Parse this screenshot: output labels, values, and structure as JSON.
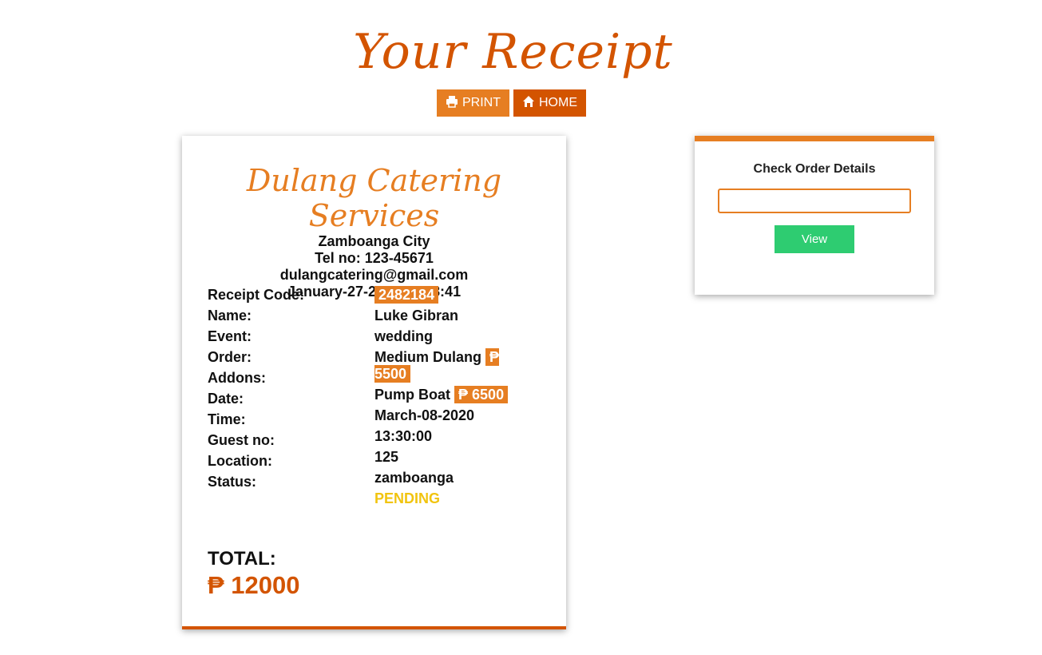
{
  "header": {
    "title": "Your Receipt",
    "print_label": "PRINT",
    "home_label": "HOME",
    "print_icon": "print-icon",
    "home_icon": "home-icon"
  },
  "receipt": {
    "business_name": "Dulang Catering Services",
    "city": "Zamboanga City",
    "tel": "Tel no: 123-45671",
    "email": "dulangcatering@gmail.com",
    "datetime": "January-27-2020 11:08:41",
    "labels": [
      "Receipt Code:",
      "Name:",
      "Event:",
      "Order:",
      "Addons:",
      "Date:",
      "Time:",
      "Guest no:",
      "Location:",
      "Status:"
    ],
    "values": {
      "receipt_code": "2482184",
      "name": "Luke Gibran",
      "event": "wedding",
      "order_name": "Medium Dulang",
      "order_price": "₱ 5500",
      "addon_name": "Pump Boat",
      "addon_price": "₱ 6500",
      "date": "March-08-2020",
      "time": "13:30:00",
      "guest_no": "125",
      "location": "zamboanga",
      "status": "PENDING"
    },
    "total_label": "TOTAL:",
    "total_value": "₱ 12000"
  },
  "check_order": {
    "title": "Check Order Details",
    "input_value": "",
    "button_label": "View"
  },
  "colors": {
    "accent": "#e67e22",
    "accent_dark": "#d35400",
    "view_button": "#2ecc71",
    "status_pending": "#f1c40f"
  }
}
